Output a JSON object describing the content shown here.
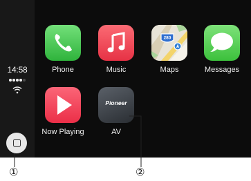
{
  "status_bar": {
    "time": "14:58",
    "signal_dots": [
      true,
      true,
      true,
      true,
      false
    ],
    "wifi_icon": "wifi-icon",
    "home_button_icon": "home-square-icon"
  },
  "apps": {
    "phone": {
      "label": "Phone",
      "icon": "phone-handset-icon",
      "color": "#34c24a"
    },
    "music": {
      "label": "Music",
      "icon": "music-note-icon",
      "color": "#f0404f"
    },
    "maps": {
      "label": "Maps",
      "icon": "map-icon",
      "badge": "280",
      "color": "#2f7fd6"
    },
    "messages": {
      "label": "Messages",
      "icon": "speech-bubble-icon",
      "color": "#4cc94a"
    },
    "now_playing": {
      "label": "Now Playing",
      "icon": "play-triangle-icon",
      "color": "#f23a52"
    },
    "av": {
      "label": "AV",
      "icon": "pioneer-logo-icon",
      "logo_text": "Pioneer",
      "color": "#3b4047"
    }
  },
  "callouts": {
    "one": "①",
    "two": "②"
  }
}
